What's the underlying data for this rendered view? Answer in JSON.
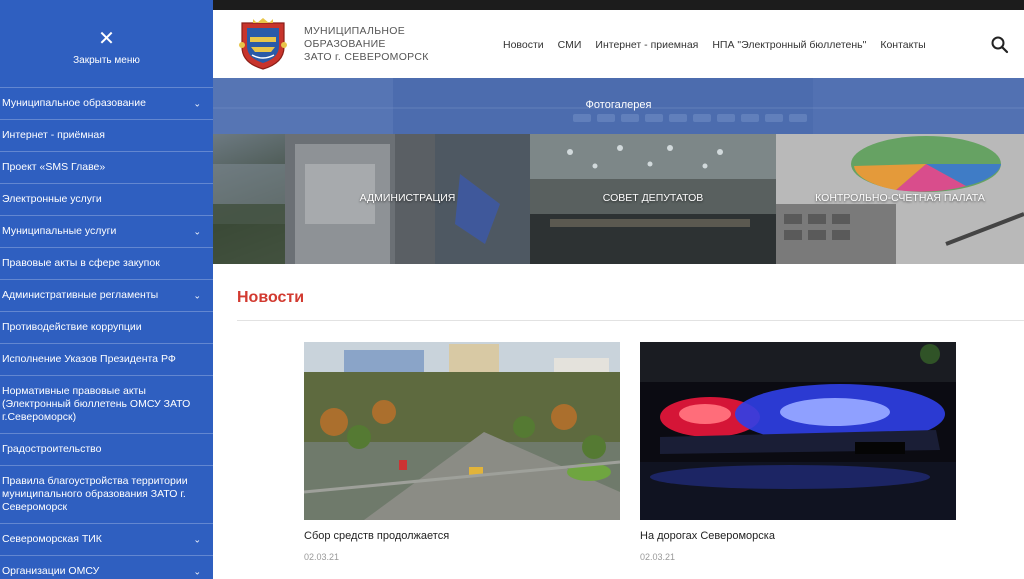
{
  "sidebar": {
    "close_label": "Закрыть меню",
    "items": [
      {
        "label": "Муниципальное образование",
        "has_children": true
      },
      {
        "label": "Интернет - приёмная",
        "has_children": false
      },
      {
        "label": "Проект «SMS Главе»",
        "has_children": false
      },
      {
        "label": "Электронные услуги",
        "has_children": false
      },
      {
        "label": "Муниципальные услуги",
        "has_children": true
      },
      {
        "label": "Правовые акты в сфере закупок",
        "has_children": false
      },
      {
        "label": "Административные регламенты",
        "has_children": true
      },
      {
        "label": "Противодействие коррупции",
        "has_children": false
      },
      {
        "label": "Исполнение Указов Президента РФ",
        "has_children": false
      },
      {
        "label": "Нормативные правовые акты (Электронный бюллетень ОМСУ ЗАТО г.Североморск)",
        "has_children": false
      },
      {
        "label": "Градостроительство",
        "has_children": false
      },
      {
        "label": "Правила благоустройства территории муниципального образования ЗАТО г. Североморск",
        "has_children": false
      },
      {
        "label": "Североморская ТИК",
        "has_children": true
      },
      {
        "label": "Организации ОМСУ",
        "has_children": true
      }
    ]
  },
  "header": {
    "org_line1": "МУНИЦИПАЛЬНОЕ",
    "org_line2": "ОБРАЗОВАНИЕ",
    "org_line3": "ЗАТО г. СЕВЕРОМОРСК",
    "nav": [
      "Новости",
      "СМИ",
      "Интернет - приемная",
      "НПА \"Электронный бюллетень\"",
      "Контакты"
    ]
  },
  "gallery": {
    "title": "Фотогалерея",
    "tiles": [
      "АДМИНИСТРАЦИЯ",
      "СОВЕТ ДЕПУТАТОВ",
      "КОНТРОЛЬНО-СЧЕТНАЯ ПАЛАТА"
    ]
  },
  "news": {
    "title": "Новости",
    "items": [
      {
        "title": "Сбор средств продолжается",
        "date": "02.03.21"
      },
      {
        "title": "На дорогах Североморска",
        "date": "02.03.21"
      }
    ]
  },
  "colors": {
    "sidebar_bg": "#2f5fc0",
    "news_accent": "#d23a30"
  }
}
